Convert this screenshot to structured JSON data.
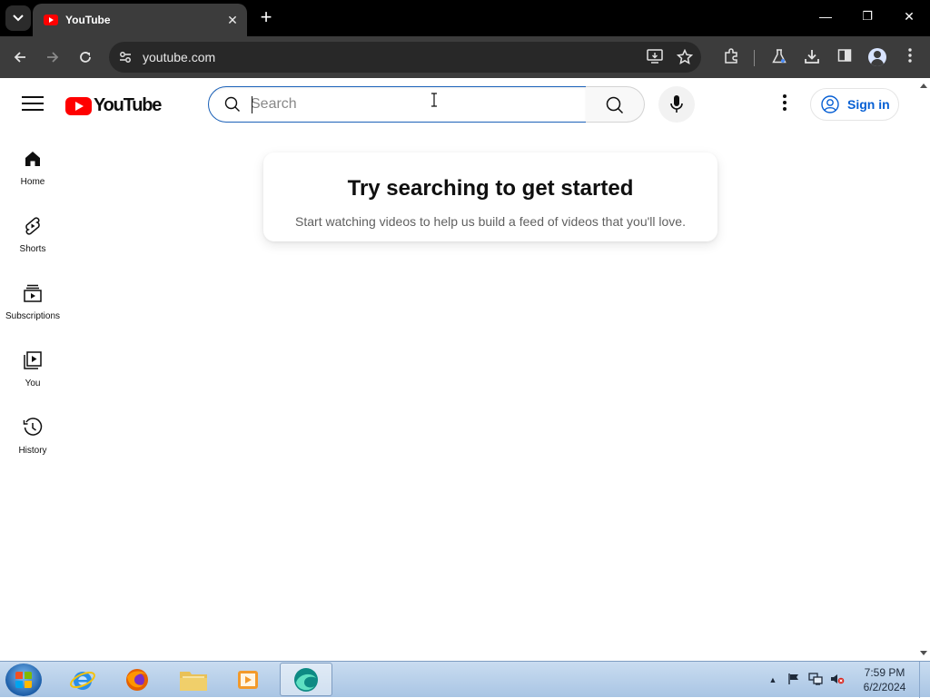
{
  "browser": {
    "tab_title": "YouTube",
    "url": "youtube.com",
    "controls": {
      "minimize": "—",
      "restore": "❐",
      "close": "✕",
      "new_tab": "+"
    }
  },
  "youtube": {
    "logo_text": "YouTube",
    "search": {
      "placeholder": "Search",
      "value": ""
    },
    "signin_label": "Sign in",
    "guide": [
      {
        "label": "Home",
        "icon": "home-icon"
      },
      {
        "label": "Shorts",
        "icon": "shorts-icon"
      },
      {
        "label": "Subscriptions",
        "icon": "subscriptions-icon"
      },
      {
        "label": "You",
        "icon": "you-icon"
      },
      {
        "label": "History",
        "icon": "history-icon"
      }
    ],
    "empty_state": {
      "title": "Try searching to get started",
      "subtitle": "Start watching videos to help us build a feed of videos that you'll love."
    }
  },
  "taskbar": {
    "apps": [
      "internet-explorer",
      "firefox",
      "file-explorer",
      "media-player",
      "browser-app"
    ],
    "clock_time": "7:59 PM",
    "clock_date": "6/2/2024"
  },
  "colors": {
    "youtube_red": "#ff0000",
    "link_blue": "#065fd4",
    "search_focus": "#1c62b9"
  }
}
